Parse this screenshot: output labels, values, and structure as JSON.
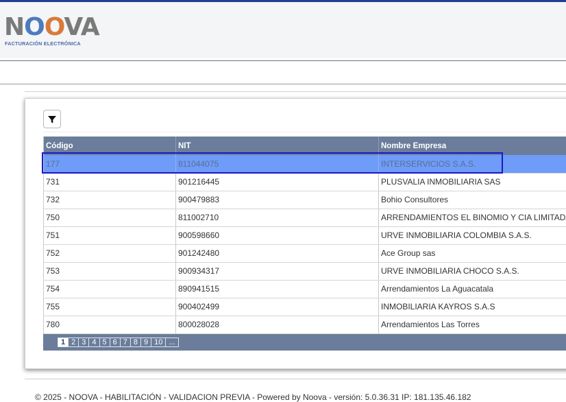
{
  "brand": {
    "logo_text": "NOOVA",
    "logo_sub": "FACTURACIÓN ELECTRÓNICA",
    "colors": {
      "top_stripe": "#1f3f8f",
      "o_blue": "#4f7bbd",
      "o_orange": "#d97a3a",
      "grid_header": "#6b7d9b",
      "selected_row": "#6e9cf8",
      "selection_outline": "#1c18c4"
    }
  },
  "toolbar": {
    "filter_icon": "filter-icon"
  },
  "grid": {
    "columns": [
      "Código",
      "NIT",
      "Nombre Empresa"
    ],
    "rows": [
      {
        "codigo": "177",
        "nit": "811044075",
        "nombre": "INTERSERVICIOS S.A.S."
      },
      {
        "codigo": "731",
        "nit": "901216445",
        "nombre": "PLUSVALIA INMOBILIARIA SAS"
      },
      {
        "codigo": "732",
        "nit": "900479883",
        "nombre": "Bohio Consultores"
      },
      {
        "codigo": "750",
        "nit": "811002710",
        "nombre": "ARRENDAMIENTOS EL BINOMIO Y CIA LIMITADA"
      },
      {
        "codigo": "751",
        "nit": "900598660",
        "nombre": "URVE INMOBILIARIA COLOMBIA S.A.S."
      },
      {
        "codigo": "752",
        "nit": "901242480",
        "nombre": "Ace Group sas"
      },
      {
        "codigo": "753",
        "nit": "900934317",
        "nombre": "URVE INMOBILIARIA CHOCO S.A.S."
      },
      {
        "codigo": "754",
        "nit": "890941515",
        "nombre": "Arrendamientos La Aguacatala"
      },
      {
        "codigo": "755",
        "nit": "900402499",
        "nombre": "INMOBILIARIA KAYROS S.A.S"
      },
      {
        "codigo": "780",
        "nit": "800028028",
        "nombre": "Arrendamientos Las Torres"
      }
    ],
    "selected_index": 0
  },
  "pager": {
    "pages": [
      "1",
      "2",
      "3",
      "4",
      "5",
      "6",
      "7",
      "8",
      "9",
      "10",
      "..."
    ],
    "current": "1"
  },
  "footer": {
    "text": "© 2025 - NOOVA - HABILITACIÓN - VALIDACION PREVIA - Powered by Noova - versión: 5.0.36.31 IP: 181.135.46.182"
  }
}
